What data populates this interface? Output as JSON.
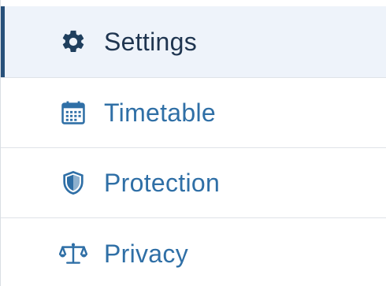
{
  "colors": {
    "active_text": "#1f3550",
    "active_icon": "#1f3f5e",
    "item_text": "#2f6fa6",
    "item_icon": "#2f6fa6",
    "active_background": "#eef3fa",
    "active_indicator": "#27507a"
  },
  "menu": {
    "active_index": 0,
    "items": [
      {
        "label": "Settings",
        "icon": "gear-icon"
      },
      {
        "label": "Timetable",
        "icon": "calendar-icon"
      },
      {
        "label": "Protection",
        "icon": "shield-icon"
      },
      {
        "label": "Privacy",
        "icon": "scales-icon"
      }
    ]
  }
}
